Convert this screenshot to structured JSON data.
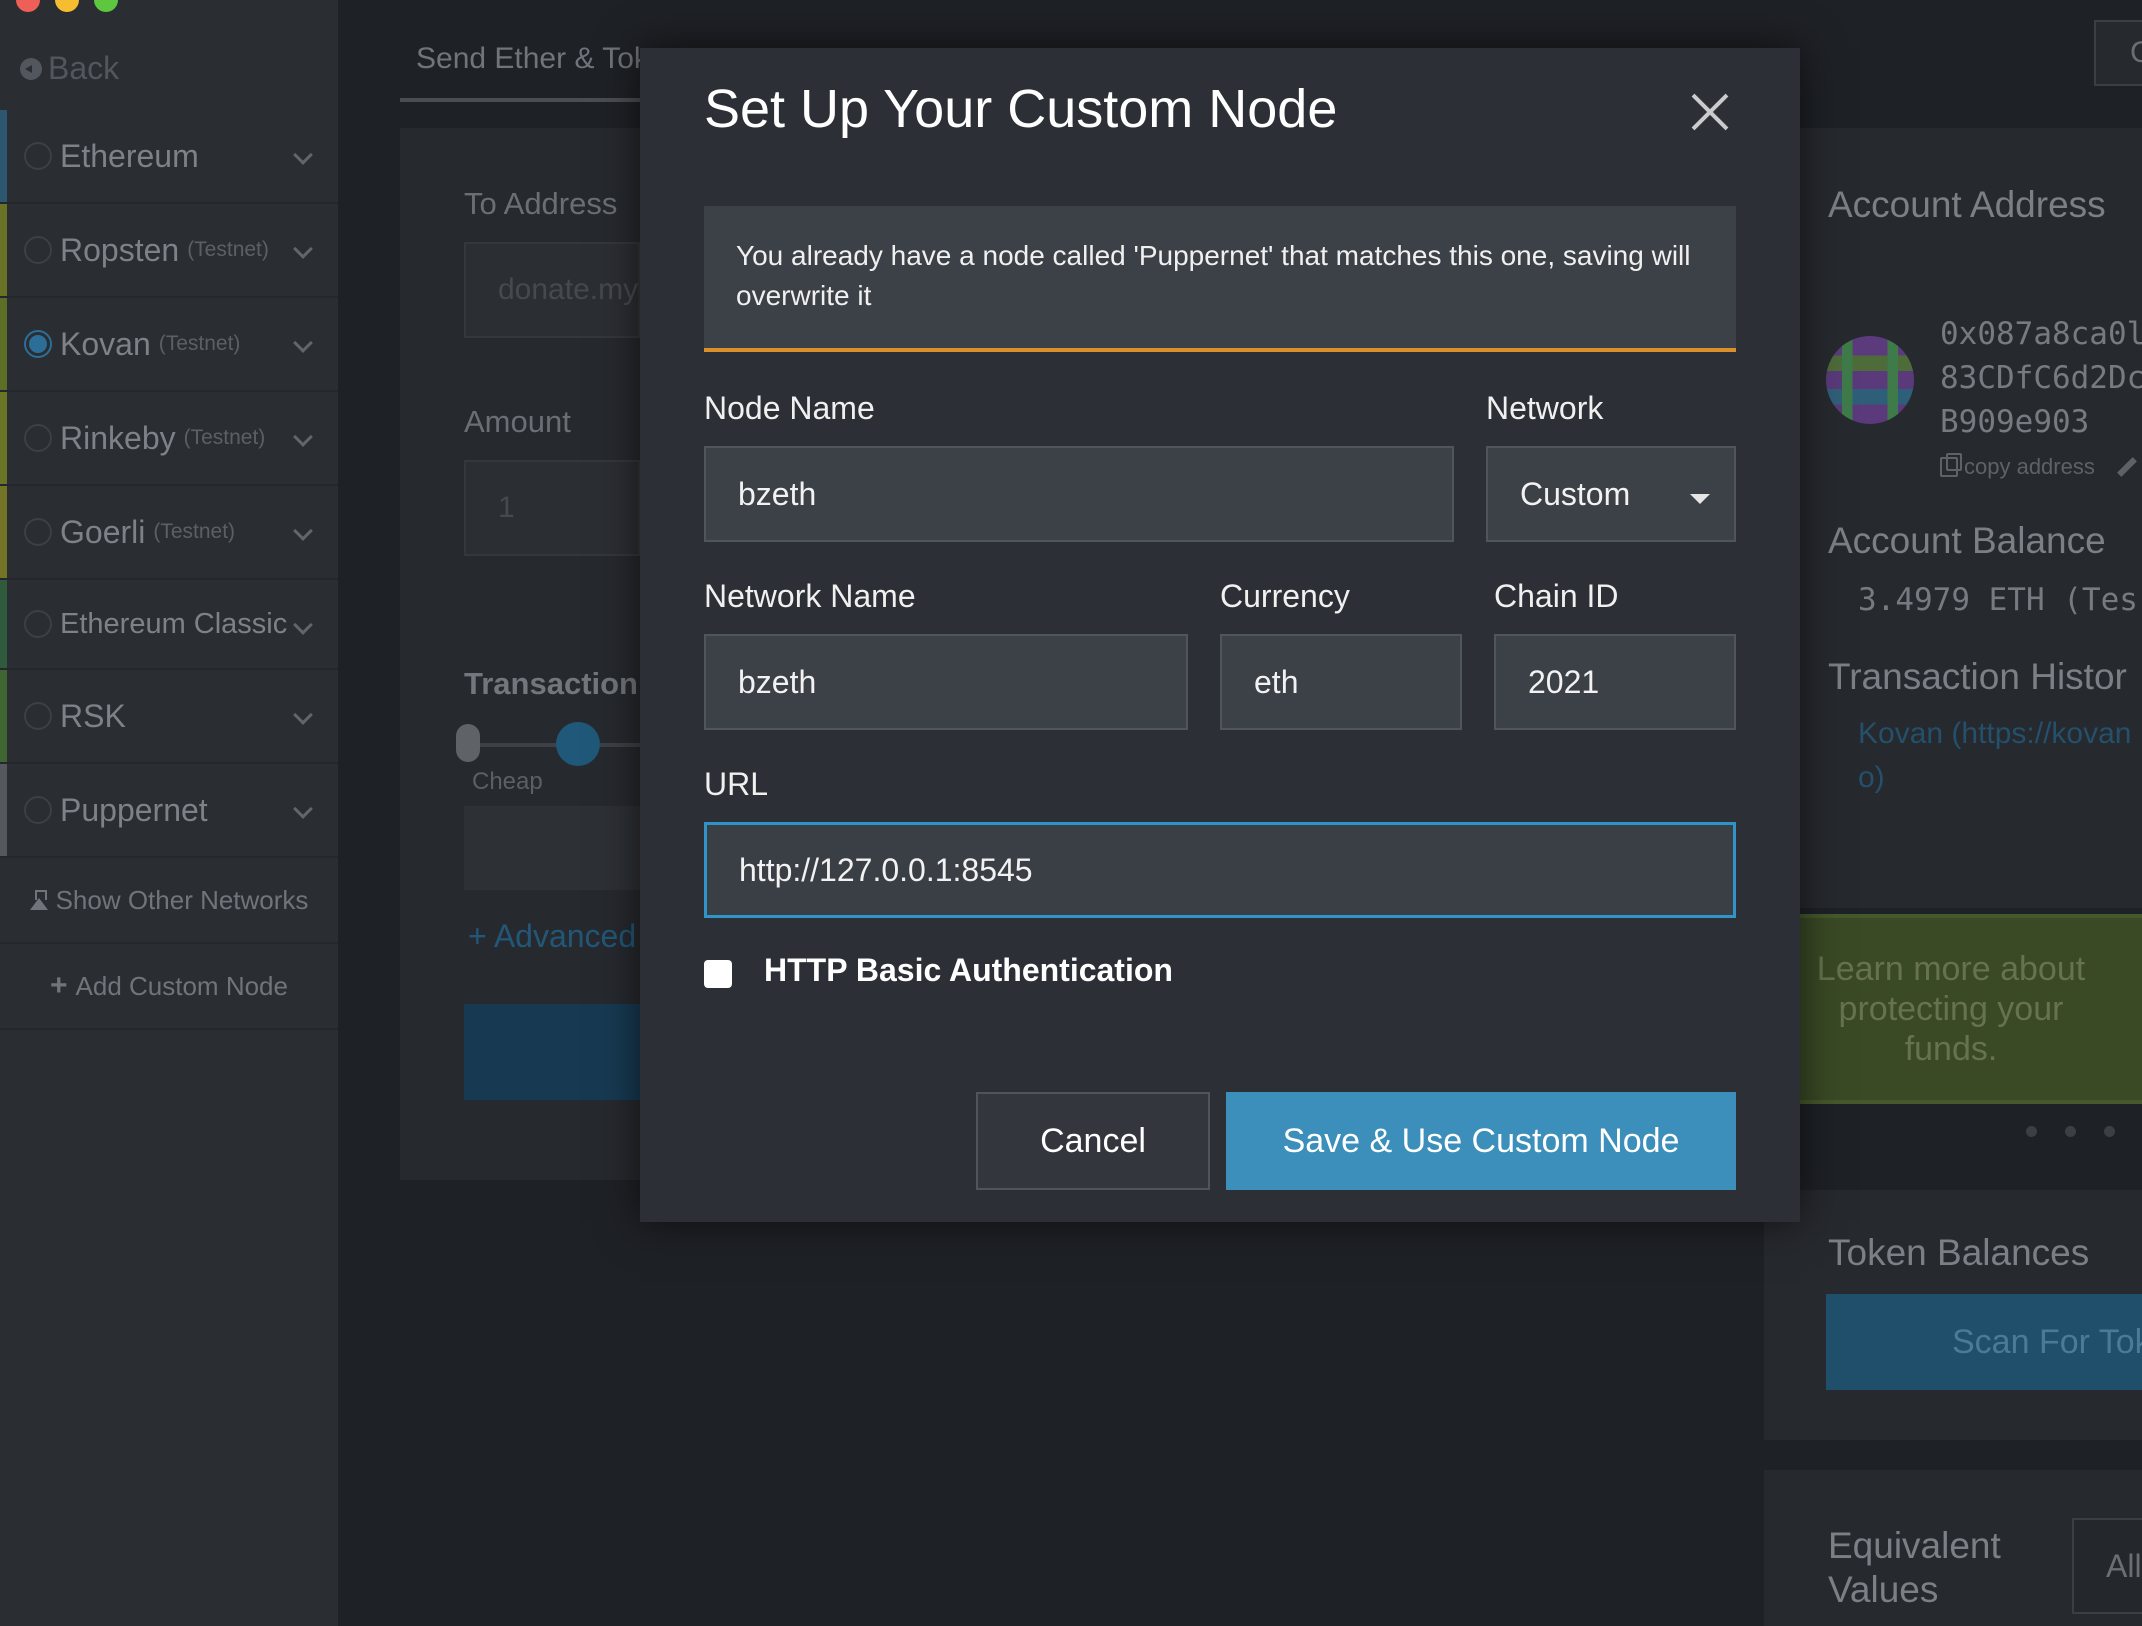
{
  "sidebar": {
    "back_label": "Back",
    "networks": [
      {
        "name": "Ethereum",
        "tag": "",
        "selected": false,
        "color": "#3a6f8f"
      },
      {
        "name": "Ropsten",
        "tag": "(Testnet)",
        "selected": false,
        "color": "#7d8a2a"
      },
      {
        "name": "Kovan",
        "tag": "(Testnet)",
        "selected": true,
        "color": "#6d7f2c"
      },
      {
        "name": "Rinkeby",
        "tag": "(Testnet)",
        "selected": false,
        "color": "#7b8a28"
      },
      {
        "name": "Goerli",
        "tag": "(Testnet)",
        "selected": false,
        "color": "#8a8a2a"
      },
      {
        "name": "Ethereum Classic",
        "tag": "",
        "selected": false,
        "color": "#3b6e4a"
      },
      {
        "name": "RSK",
        "tag": "",
        "selected": false,
        "color": "#4f7a3a"
      },
      {
        "name": "Puppernet",
        "tag": "",
        "selected": false,
        "color": "#6c6f74"
      }
    ],
    "show_other_label": "Show Other Networks",
    "add_custom_label": "Add Custom Node"
  },
  "main": {
    "tab_title": "Send Ether & Tok",
    "to_address_label": "To Address",
    "to_address_placeholder": "donate.my",
    "amount_label": "Amount",
    "amount_placeholder": "1",
    "transaction_label": "Transaction",
    "cheap_label": "Cheap",
    "advanced_label": "+ Advanced"
  },
  "right": {
    "top_button": "C",
    "account_address_label": "Account Address",
    "address_lines": [
      "0x087a8ca0l",
      "83CDfC6d2Dc",
      "B909e903"
    ],
    "copy_address_label": "copy address",
    "account_balance_label": "Account Balance",
    "balance_value": "3.4979 ETH (Tes",
    "tx_history_label": "Transaction Histor",
    "tx_link_lines": [
      "Kovan (https://kovan",
      "o)"
    ],
    "promo_text": "Learn more about protecting your funds.",
    "token_balances_label": "Token Balances",
    "scan_button": "Scan For Tok",
    "equivalent_values_label": "Equivalent Values",
    "all_button": "All"
  },
  "modal": {
    "title": "Set Up Your Custom Node",
    "warning": "You already have a node called 'Puppernet' that matches this one, saving will overwrite it",
    "node_name_label": "Node Name",
    "node_name_value": "bzeth",
    "network_label": "Network",
    "network_value": "Custom",
    "network_name_label": "Network Name",
    "network_name_value": "bzeth",
    "currency_label": "Currency",
    "currency_value": "eth",
    "chain_id_label": "Chain ID",
    "chain_id_value": "2021",
    "url_label": "URL",
    "url_value": "http://127.0.0.1:8545",
    "http_auth_label": "HTTP Basic Authentication",
    "http_auth_checked": false,
    "cancel_label": "Cancel",
    "save_label": "Save & Use Custom Node"
  },
  "colors": {
    "accent": "#3b8fba",
    "warning_border": "#d98f2a",
    "focus_border": "#2f95c8"
  }
}
